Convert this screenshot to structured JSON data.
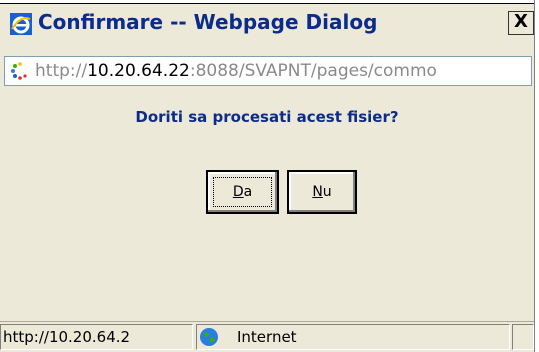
{
  "window": {
    "title": "Confirmare -- Webpage Dialog",
    "close_label": "X"
  },
  "address_bar": {
    "prefix": "http://",
    "host": "10.20.64.22",
    "rest": ":8088/SVAPNT/pages/commo"
  },
  "dialog": {
    "question": "Doriti sa procesati acest fisier?",
    "yes_button": {
      "mnemonic": "D",
      "rest": "a"
    },
    "no_button": {
      "mnemonic": "N",
      "rest": "u"
    }
  },
  "status_bar": {
    "url": "http://10.20.64.2",
    "zone": "Internet"
  },
  "colors": {
    "title_text": "#0c2c8c",
    "window_bg": "#ece9d8"
  },
  "icons": [
    "ie-logo-icon",
    "loading-icon",
    "globe-icon"
  ]
}
